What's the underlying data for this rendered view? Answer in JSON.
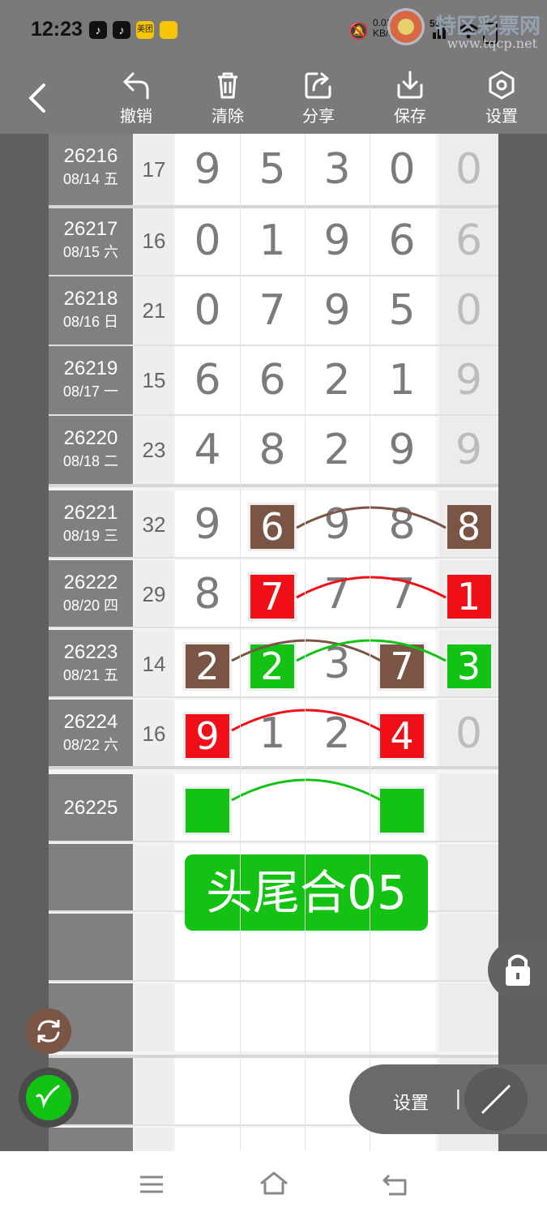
{
  "status": {
    "time": "12:23",
    "net": "0.01\nKB/s",
    "signal": "5G",
    "app_badge": "美团",
    "watermark": "特区彩票网",
    "watermark_url": "www.tqcp.net"
  },
  "toolbar": {
    "undo": "撤销",
    "clear": "清除",
    "share": "分享",
    "save": "保存",
    "settings": "设置"
  },
  "rows": [
    {
      "issue": "26216",
      "date": "08/14 五",
      "sum": "17",
      "digits": [
        "9",
        "5",
        "3",
        "0"
      ],
      "tail": "0"
    },
    {
      "issue": "26217",
      "date": "08/15 六",
      "sum": "16",
      "digits": [
        "0",
        "1",
        "9",
        "6"
      ],
      "tail": "6"
    },
    {
      "issue": "26218",
      "date": "08/16 日",
      "sum": "21",
      "digits": [
        "0",
        "7",
        "9",
        "5"
      ],
      "tail": "0"
    },
    {
      "issue": "26219",
      "date": "08/17 一",
      "sum": "15",
      "digits": [
        "6",
        "6",
        "2",
        "1"
      ],
      "tail": "9"
    },
    {
      "issue": "26220",
      "date": "08/18 二",
      "sum": "23",
      "digits": [
        "4",
        "8",
        "2",
        "9"
      ],
      "tail": "9"
    },
    {
      "issue": "26221",
      "date": "08/19 三",
      "sum": "32",
      "digits": [
        "9",
        "6",
        "9",
        "8"
      ],
      "tail": "8"
    },
    {
      "issue": "26222",
      "date": "08/20 四",
      "sum": "29",
      "digits": [
        "8",
        "7",
        "7",
        "7"
      ],
      "tail": "1"
    },
    {
      "issue": "26223",
      "date": "08/21 五",
      "sum": "14",
      "digits": [
        "2",
        "2",
        "3",
        "7"
      ],
      "tail": "3"
    },
    {
      "issue": "26224",
      "date": "08/22 六",
      "sum": "16",
      "digits": [
        "9",
        "1",
        "2",
        "4"
      ],
      "tail": "0"
    },
    {
      "issue": "26225",
      "date": "",
      "sum": "",
      "digits": [
        "",
        "",
        "",
        ""
      ],
      "tail": ""
    }
  ],
  "prediction_label": "头尾合05",
  "colors": {
    "brown": "#7a5545",
    "red": "#f00f16",
    "green": "#13c313",
    "label_bg": "#14c214"
  },
  "bottom_panel": {
    "settings_label": "设置",
    "divider": "|"
  },
  "icons": [
    "back-icon",
    "undo-icon",
    "trash-icon",
    "share-icon",
    "download-icon",
    "settings-icon",
    "lock-icon",
    "refresh-icon",
    "pen-icon",
    "menu-icon",
    "home-icon",
    "return-icon"
  ]
}
